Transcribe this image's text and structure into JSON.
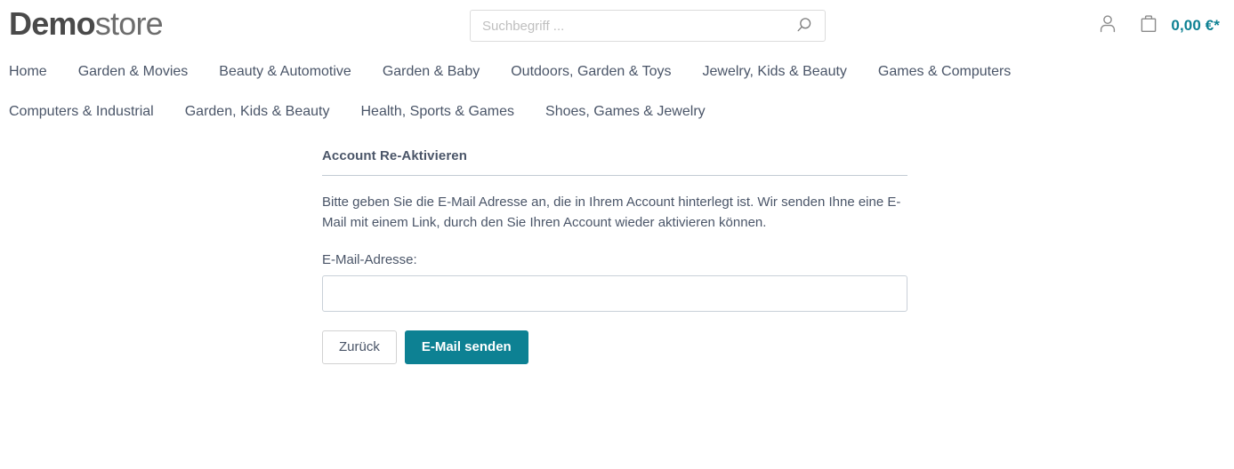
{
  "header": {
    "logo": {
      "strong": "Demo",
      "light": "store"
    },
    "search": {
      "placeholder": "Suchbegriff ...",
      "value": "",
      "icon": "search-icon"
    },
    "actions": {
      "account_icon": "user-icon",
      "cart_icon": "shopping-bag-icon",
      "cart_amount": "0,00 €*"
    }
  },
  "nav": {
    "rows": [
      [
        {
          "label": "Home"
        },
        {
          "label": "Garden & Movies"
        },
        {
          "label": "Beauty & Automotive"
        },
        {
          "label": "Garden & Baby"
        },
        {
          "label": "Outdoors, Garden & Toys"
        },
        {
          "label": "Jewelry, Kids & Beauty"
        },
        {
          "label": "Games & Computers"
        }
      ],
      [
        {
          "label": "Computers & Industrial"
        },
        {
          "label": "Garden, Kids & Beauty"
        },
        {
          "label": "Health, Sports & Games"
        },
        {
          "label": "Shoes, Games & Jewelry"
        }
      ]
    ]
  },
  "main": {
    "title": "Account Re-Aktivieren",
    "description": "Bitte geben Sie die E-Mail Adresse an, die in Ihrem Account hinterlegt ist. Wir senden Ihne eine E-Mail mit einem Link, durch den Sie Ihren Account wieder aktivieren können.",
    "email_label": "E-Mail-Adresse:",
    "email_value": "",
    "email_placeholder": "",
    "buttons": {
      "back": "Zurück",
      "submit": "E-Mail senden"
    }
  },
  "colors": {
    "accent": "#0d8193",
    "text": "#4a5568",
    "logo_strong": "#4a4a4a",
    "logo_light": "#6d6d6d",
    "border": "#c9d0d8",
    "divider": "#c2cbd4"
  }
}
